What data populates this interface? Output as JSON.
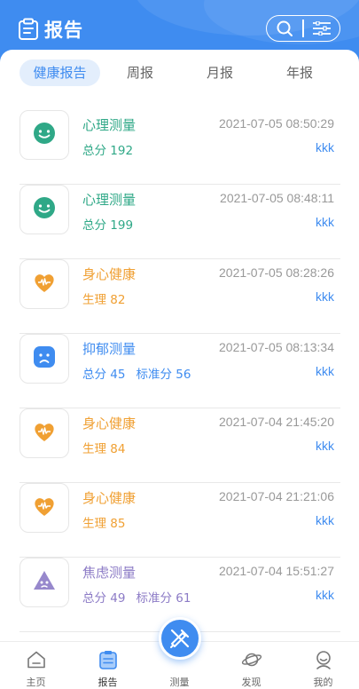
{
  "header": {
    "title": "报告"
  },
  "tabs": [
    {
      "label": "健康报告",
      "active": true
    },
    {
      "label": "周报",
      "active": false
    },
    {
      "label": "月报",
      "active": false
    },
    {
      "label": "年报",
      "active": false
    }
  ],
  "reports": [
    {
      "name": "心理测量",
      "time": "2021-07-05 08:50:29",
      "detail1": "总分 192",
      "detail2": "",
      "user": "kkk",
      "icon": "smile-face-icon",
      "color": "#2fa887"
    },
    {
      "name": "心理测量",
      "time": "2021-07-05 08:48:11",
      "detail1": "总分 199",
      "detail2": "",
      "user": "kkk",
      "icon": "smile-face-icon",
      "color": "#2fa887"
    },
    {
      "name": "身心健康",
      "time": "2021-07-05 08:28:26",
      "detail1": "生理 82",
      "detail2": "",
      "user": "kkk",
      "icon": "heart-pulse-icon",
      "color": "#f0a033"
    },
    {
      "name": "抑郁测量",
      "time": "2021-07-05 08:13:34",
      "detail1": "总分 45",
      "detail2": "标准分 56",
      "user": "kkk",
      "icon": "sad-face-icon",
      "color": "#3f8cf0"
    },
    {
      "name": "身心健康",
      "time": "2021-07-04 21:45:20",
      "detail1": "生理 84",
      "detail2": "",
      "user": "kkk",
      "icon": "heart-pulse-icon",
      "color": "#f0a033"
    },
    {
      "name": "身心健康",
      "time": "2021-07-04 21:21:06",
      "detail1": "生理 85",
      "detail2": "",
      "user": "kkk",
      "icon": "heart-pulse-icon",
      "color": "#f0a033"
    },
    {
      "name": "焦虑测量",
      "time": "2021-07-04 15:51:27",
      "detail1": "总分 49",
      "detail2": "标准分 61",
      "user": "kkk",
      "icon": "anxious-face-icon",
      "color": "#8c7bc6"
    }
  ],
  "nav": [
    {
      "label": "主页",
      "icon": "home-icon"
    },
    {
      "label": "报告",
      "icon": "report-icon"
    },
    {
      "label": "测量",
      "icon": "measure-icon"
    },
    {
      "label": "发现",
      "icon": "planet-icon"
    },
    {
      "label": "我的",
      "icon": "profile-icon"
    }
  ],
  "colors": {
    "primary": "#3f8cf0",
    "green": "#2fa887",
    "orange": "#f0a033",
    "purple": "#8c7bc6"
  }
}
